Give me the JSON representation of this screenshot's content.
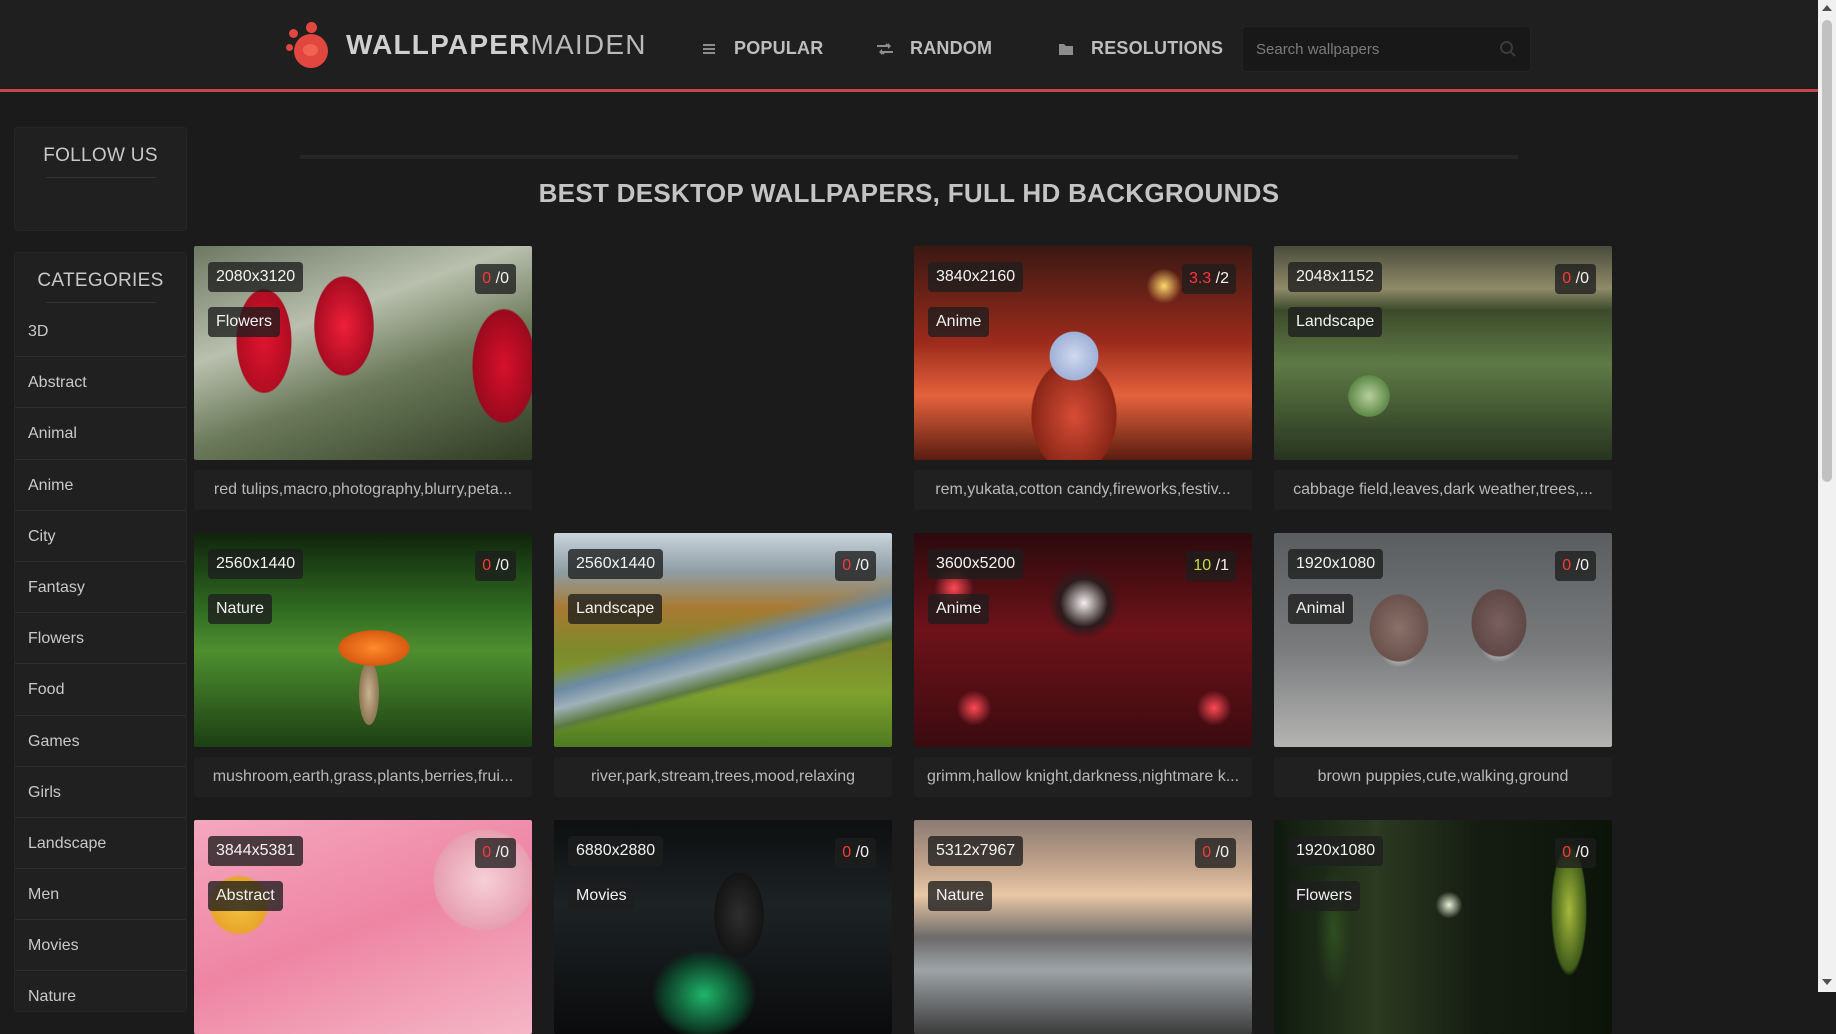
{
  "header": {
    "logo_bold": "WALLPAPER",
    "logo_light": "MAIDEN",
    "nav": {
      "popular": "POPULAR",
      "random": "RANDOM",
      "resolutions": "RESOLUTIONS"
    },
    "search_placeholder": "Search wallpapers",
    "accent_color": "#c5454d"
  },
  "sidebar": {
    "follow_title": "FOLLOW US",
    "categories_title": "CATEGORIES",
    "categories": [
      "3D",
      "Abstract",
      "Animal",
      "Anime",
      "City",
      "Fantasy",
      "Flowers",
      "Food",
      "Games",
      "Girls",
      "Landscape",
      "Men",
      "Movies",
      "Nature"
    ]
  },
  "main": {
    "title": "BEST DESKTOP WALLPAPERS, FULL HD BACKGROUNDS",
    "cards": [
      {
        "resolution": "2080x3120",
        "category": "Flowers",
        "rating": "0",
        "votes": "/0",
        "tags": "red tulips,macro,photography,blurry,peta...",
        "theme": "tulips"
      },
      {
        "resolution": "3840x2160",
        "category": "Anime",
        "rating": "3.3",
        "votes": "/2",
        "tags": "rem,yukata,cotton candy,fireworks,festiv...",
        "theme": "festival"
      },
      {
        "resolution": "2048x1152",
        "category": "Landscape",
        "rating": "0",
        "votes": "/0",
        "tags": "cabbage field,leaves,dark weather,trees,...",
        "theme": "cabbage"
      },
      {
        "resolution": "2560x1440",
        "category": "Nature",
        "rating": "0",
        "votes": "/0",
        "tags": "mushroom,earth,grass,plants,berries,frui...",
        "theme": "mushroom"
      },
      {
        "resolution": "2560x1440",
        "category": "Landscape",
        "rating": "0",
        "votes": "/0",
        "tags": "river,park,stream,trees,mood,relaxing",
        "theme": "river"
      },
      {
        "resolution": "3600x5200",
        "category": "Anime",
        "rating": "10",
        "votes": "/1",
        "tags": "grimm,hallow knight,darkness,nightmare k...",
        "theme": "grimm"
      },
      {
        "resolution": "1920x1080",
        "category": "Animal",
        "rating": "0",
        "votes": "/0",
        "tags": "brown puppies,cute,walking,ground",
        "theme": "puppies"
      },
      {
        "resolution": "3844x5381",
        "category": "Abstract",
        "rating": "0",
        "votes": "/0",
        "tags": "",
        "theme": "pink"
      },
      {
        "resolution": "6880x2880",
        "category": "Movies",
        "rating": "0",
        "votes": "/0",
        "tags": "",
        "theme": "saber"
      },
      {
        "resolution": "5312x7967",
        "category": "Nature",
        "rating": "0",
        "votes": "/0",
        "tags": "",
        "theme": "beach"
      },
      {
        "resolution": "1920x1080",
        "category": "Flowers",
        "rating": "0",
        "votes": "/0",
        "tags": "",
        "theme": "plant"
      }
    ]
  }
}
